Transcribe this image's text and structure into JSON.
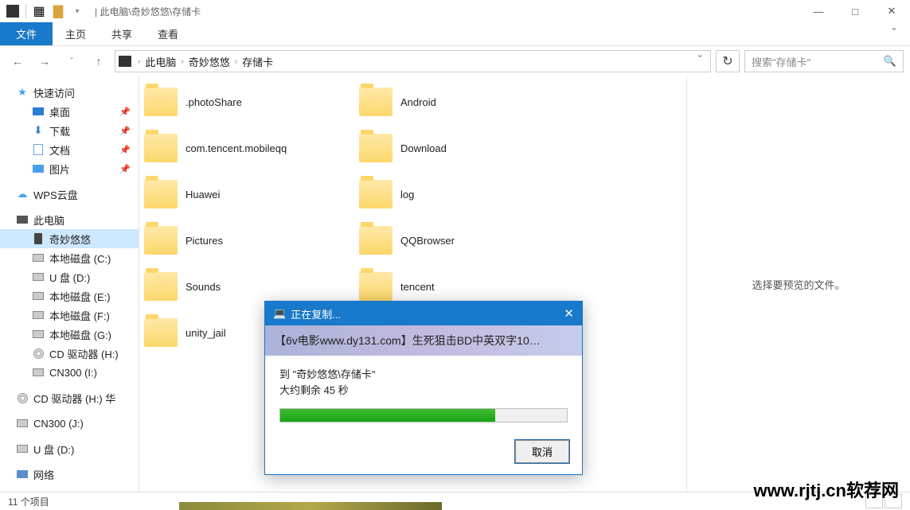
{
  "titlebar": {
    "path": "| 此电脑\\奇妙悠悠\\存储卡"
  },
  "window": {
    "min": "—",
    "max": "□",
    "close": "✕"
  },
  "ribbon": {
    "file": "文件",
    "tabs": [
      "主页",
      "共享",
      "查看"
    ],
    "expand": "ˇ"
  },
  "nav": {
    "back": "←",
    "fwd": "→",
    "recent": "ˇ",
    "up": "↑"
  },
  "breadcrumbs": [
    "此电脑",
    "奇妙悠悠",
    "存储卡"
  ],
  "refresh": "↻",
  "search": {
    "placeholder": "搜索\"存储卡\"",
    "icon": "🔍"
  },
  "sidebar": {
    "quick": {
      "label": "快速访问",
      "items": [
        "桌面",
        "下载",
        "文档",
        "图片"
      ]
    },
    "wps": "WPS云盘",
    "pc": {
      "label": "此电脑",
      "items": [
        "奇妙悠悠",
        "本地磁盘 (C:)",
        "U 盘 (D:)",
        "本地磁盘 (E:)",
        "本地磁盘 (F:)",
        "本地磁盘 (G:)",
        "CD 驱动器 (H:)",
        "CN300 (I:)"
      ]
    },
    "cd_ext": "CD 驱动器 (H:) 华",
    "cn_ext": "CN300 (J:)",
    "u_ext": "U 盘 (D:)",
    "network": "网络"
  },
  "folders": [
    ".photoShare",
    "Android",
    "com.tencent.mobileqq",
    "Download",
    "Huawei",
    "log",
    "Pictures",
    "QQBrowser",
    "Sounds",
    "tencent",
    "unity_jail"
  ],
  "preview": "选择要预览的文件。",
  "status": "11 个项目",
  "dialog": {
    "title_icon": "💻",
    "title": "正在复制...",
    "banner": "【6v电影www.dy131.com】生死狙击BD中英双字10…",
    "dest": "到 \"奇妙悠悠\\存储卡\"",
    "remain": "大约剩余 45 秒",
    "cancel": "取消",
    "close": "✕"
  },
  "watermark": "www.rjtj.cn软荐网"
}
